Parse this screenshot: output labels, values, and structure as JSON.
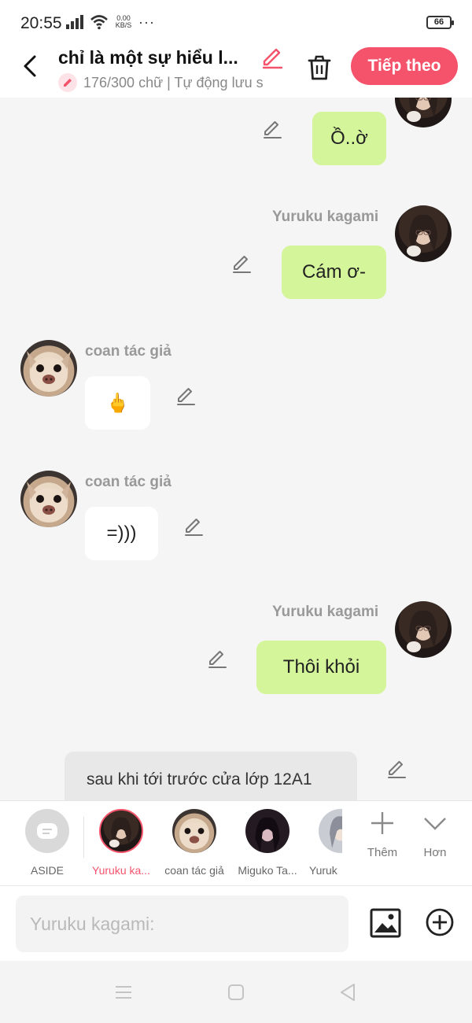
{
  "status_bar": {
    "time": "20:55",
    "speed_value": "0.00",
    "speed_unit": "KB/S",
    "more": "···",
    "battery": "66"
  },
  "header": {
    "title": "chỉ là một sự hiểu l...",
    "subtitle": "176/300 chữ | Tự động lưu s",
    "next_label": "Tiếp theo",
    "accent_color": "#f4536b"
  },
  "messages": [
    {
      "side": "right",
      "name": "",
      "text": "Ồ..ờ"
    },
    {
      "side": "right",
      "name": "Yuruku kagami",
      "text": "Cám ơ-"
    },
    {
      "side": "left",
      "name": "coan tác giả",
      "text": "🖕"
    },
    {
      "side": "left",
      "name": "coan tác giả",
      "text": "=)))"
    },
    {
      "side": "right",
      "name": "Yuruku kagami",
      "text": "Thôi khỏi"
    }
  ],
  "aside_text": "sau khi tới trước cửa lớp 12A1",
  "characters": [
    {
      "label": "ASIDE",
      "icon": "aside-icon"
    },
    {
      "label": "Yuruku ka...",
      "icon": "avatar-girl",
      "selected": true
    },
    {
      "label": "coan tác giả",
      "icon": "avatar-dog"
    },
    {
      "label": "Miguko Ta...",
      "icon": "avatar-girl-dark"
    },
    {
      "label": "Yuruk",
      "icon": "avatar-girl"
    }
  ],
  "tools": {
    "add_label": "Thêm",
    "more_label": "Hơn"
  },
  "input": {
    "placeholder": "Yuruku kagami:"
  },
  "colors": {
    "my_bubble": "#d4f59a",
    "other_bubble": "#ffffff",
    "background": "#f5f5f5"
  }
}
